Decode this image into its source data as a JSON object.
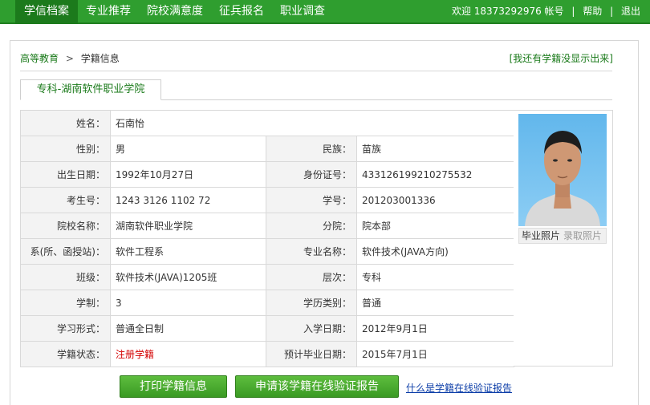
{
  "nav": {
    "items": [
      "学信档案",
      "专业推荐",
      "院校满意度",
      "征兵报名",
      "职业调查"
    ],
    "user": {
      "welcome": "欢迎 18373292976 帐号",
      "sep1": "|",
      "help": "帮助",
      "sep2": "|",
      "logout": "退出"
    }
  },
  "breadcrumb": {
    "home": "高等教育",
    "gt": ">",
    "current": "学籍信息"
  },
  "missing_link": "[我还有学籍没显示出来]",
  "tab": {
    "label": "专科-湖南软件职业学院"
  },
  "info": {
    "name_label": "姓名：",
    "name": "石南怡",
    "gender_label": "性别：",
    "gender": "男",
    "ethnicity_label": "民族：",
    "ethnicity": "苗族",
    "birth_label": "出生日期：",
    "birth": "1992年10月27日",
    "id_label": "身份证号：",
    "id": "433126199210275532",
    "exam_no_label": "考生号：",
    "exam_no": "1243 3126 1102 72",
    "student_no_label": "学号：",
    "student_no": "201203001336",
    "school_label": "院校名称：",
    "school": "湖南软件职业学院",
    "branch_label": "分院：",
    "branch": "院本部",
    "dept_label": "系(所、函授站)：",
    "dept": "软件工程系",
    "major_label": "专业名称：",
    "major": "软件技术(JAVA方向)",
    "class_label": "班级：",
    "class": "软件技术(JAVA)1205班",
    "level_label": "层次：",
    "level": "专科",
    "duration_label": "学制：",
    "duration": "3",
    "category_label": "学历类别：",
    "category": "普通",
    "form_label": "学习形式：",
    "form": "普通全日制",
    "enroll_label": "入学日期：",
    "enroll": "2012年9月1日",
    "status_label": "学籍状态：",
    "status": "注册学籍",
    "grad_label": "预计毕业日期：",
    "grad": "2015年7月1日"
  },
  "photo": {
    "grad_label": "毕业照片",
    "enroll_label": "录取照片"
  },
  "buttons": {
    "print": "打印学籍信息",
    "apply": "申请该学籍在线验证报告"
  },
  "help_link": "什么是学籍在线验证报告",
  "colors": {
    "nav_green": "#2f9e2f",
    "accent_green": "#1a7a1a",
    "status_red": "#d40000",
    "link_blue": "#0d3ea8"
  }
}
